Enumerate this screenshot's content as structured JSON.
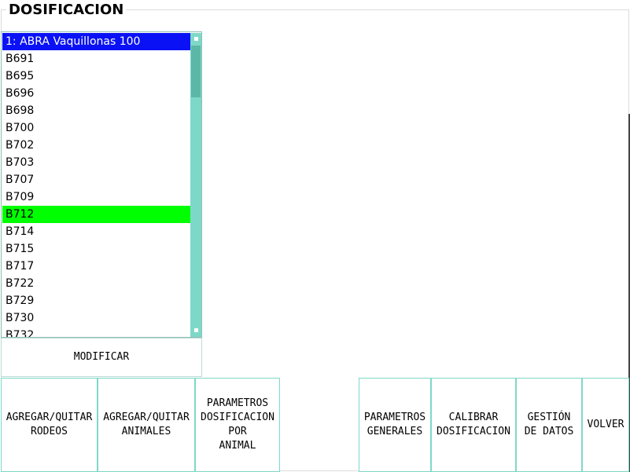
{
  "title": "DOSIFICACION",
  "list": {
    "items": [
      "1: ABRA Vaquillonas 100",
      "B691",
      "B695",
      "B696",
      "B698",
      "B700",
      "B702",
      "B703",
      "B707",
      "B709",
      "B712",
      "B714",
      "B715",
      "B717",
      "B722",
      "B729",
      "B730",
      "B732"
    ],
    "selected_index": 0,
    "highlighted_index": 10,
    "selected_color": "#0a12f5",
    "highlighted_color": "#00ff00",
    "scrollbar_color": "#7ed8c8"
  },
  "buttons": {
    "modificar": "MODIFICAR",
    "agregar_quitar_rodeos": "AGREGAR/QUITAR\nRODEOS",
    "agregar_quitar_animales": "AGREGAR/QUITAR\nANIMALES",
    "parametros_dosificacion_por_animal": "PARAMETROS\nDOSIFICACION\nPOR\nANIMAL",
    "parametros_generales": "PARAMETROS\nGENERALES",
    "calibrar_dosificacion": "CALIBRAR\nDOSIFICACION",
    "gestion_de_datos": "GESTIÓN\nDE DATOS",
    "volver": "VOLVER"
  }
}
